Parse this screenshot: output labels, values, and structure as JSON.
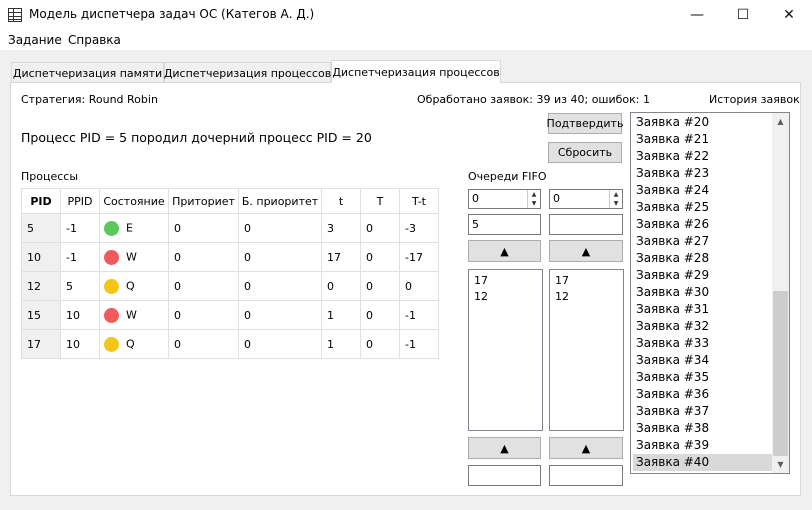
{
  "window": {
    "title": "Модель диспетчера задач ОС (Категов А. Д.)",
    "minimize_glyph": "—",
    "maximize_glyph": "☐",
    "close_glyph": "✕"
  },
  "menu": [
    "Задание",
    "Справка"
  ],
  "tabs": [
    "Диспетчеризация памяти",
    "Диспетчеризация процессов",
    "Диспетчеризация процессов"
  ],
  "strategy": "Стратегия: Round Robin",
  "stats": "Обработано заявок: 39 из 40; ошибок: 1",
  "history_label": "История заявок",
  "message": "Процесс PID = 5 породил дочерний процесс PID = 20",
  "buttons": {
    "confirm": "Подтвердить",
    "reset": "Сбросить"
  },
  "processes_label": "Процессы",
  "queues_label": "Очереди FIFO",
  "table": {
    "headers": [
      "PID",
      "PPID",
      "Состояние",
      "Приториет",
      "Б. приоритет",
      "t",
      "T",
      "T-t"
    ],
    "rows": [
      [
        "5",
        "-1",
        "E",
        "0",
        "0",
        "3",
        "0",
        "-3"
      ],
      [
        "10",
        "-1",
        "W",
        "0",
        "0",
        "17",
        "0",
        "-17"
      ],
      [
        "12",
        "5",
        "Q",
        "0",
        "0",
        "0",
        "0",
        "0"
      ],
      [
        "15",
        "10",
        "W",
        "0",
        "0",
        "1",
        "0",
        "-1"
      ],
      [
        "17",
        "10",
        "Q",
        "0",
        "0",
        "1",
        "0",
        "-1"
      ]
    ],
    "state_colors": {
      "E": "#5cc85c",
      "W": "#f05a5a",
      "Q": "#f5c518"
    }
  },
  "queues": [
    {
      "spin_value": "0",
      "field_value": "5",
      "up_label": "▲",
      "items": [
        "17",
        "12"
      ],
      "bottom_up_label": "▲",
      "bottom_field": ""
    },
    {
      "spin_value": "0",
      "field_value": "",
      "up_label": "▲",
      "items": [
        "17",
        "12"
      ],
      "bottom_up_label": "▲",
      "bottom_field": ""
    }
  ],
  "history": {
    "items": [
      "Заявка #20",
      "Заявка #21",
      "Заявка #22",
      "Заявка #23",
      "Заявка #24",
      "Заявка #25",
      "Заявка #26",
      "Заявка #27",
      "Заявка #28",
      "Заявка #29",
      "Заявка #30",
      "Заявка #31",
      "Заявка #32",
      "Заявка #33",
      "Заявка #34",
      "Заявка #35",
      "Заявка #36",
      "Заявка #37",
      "Заявка #38",
      "Заявка #39",
      "Заявка #40"
    ],
    "selected": "Заявка #40"
  }
}
